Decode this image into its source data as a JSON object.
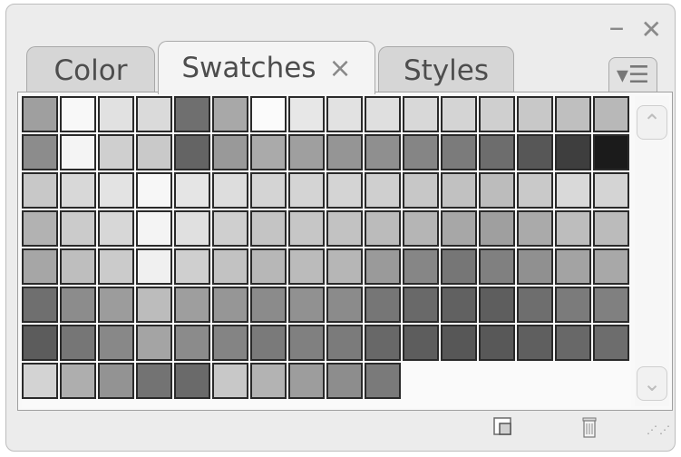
{
  "window": {
    "minimize_icon": "minus",
    "close_icon": "x"
  },
  "tabs": [
    {
      "label": "Color"
    },
    {
      "label": "Swatches",
      "close_symbol": "×"
    },
    {
      "label": "Styles"
    }
  ],
  "panel_menu_icon": "▾☰",
  "scrollbar": {
    "up_icon": "⌃",
    "down_icon": "⌄"
  },
  "swatches": [
    [
      "#9f9f9f",
      "#f8f8f8",
      "#e1e1e1",
      "#dadada",
      "#6f6f6f",
      "#a8a8a8",
      "#fbfbfb",
      "#e7e7e7",
      "#e2e2e2",
      "#dfdfdf",
      "#d8d8d8",
      "#d4d4d4",
      "#cfcfcf",
      "#c8c8c8",
      "#bfbfbf",
      "#b8b8b8"
    ],
    [
      "#8c8c8c",
      "#f4f4f4",
      "#cfcfcf",
      "#c9c9c9",
      "#646464",
      "#999999",
      "#aaaaaa",
      "#9f9f9f",
      "#959595",
      "#8f8f8f",
      "#858585",
      "#7b7b7b",
      "#6d6d6d",
      "#575757",
      "#3e3e3e",
      "#1b1b1b"
    ],
    [
      "#c8c8c8",
      "#d8d8d8",
      "#e3e3e3",
      "#f7f7f7",
      "#e5e5e5",
      "#dddddd",
      "#d4d4d4",
      "#d4d4d4",
      "#d4d4d4",
      "#cfcfcf",
      "#c7c7c7",
      "#c1c1c1",
      "#bcbcbc",
      "#c9c9c9",
      "#d9d9d9",
      "#d4d4d4"
    ],
    [
      "#b2b2b2",
      "#cbcbcb",
      "#d7d7d7",
      "#f4f4f4",
      "#e0e0e0",
      "#cfcfcf",
      "#c4c4c4",
      "#c6c6c6",
      "#c2c2c2",
      "#bbbbbb",
      "#b5b5b5",
      "#a7a7a7",
      "#9f9f9f",
      "#aaaaaa",
      "#bdbdbd",
      "#bbbbbb"
    ],
    [
      "#a6a6a6",
      "#bebebe",
      "#cbcbcb",
      "#f0f0f0",
      "#cfcfcf",
      "#c2c2c2",
      "#b7b7b7",
      "#bbbbbb",
      "#b6b6b6",
      "#9a9a9a",
      "#868686",
      "#767676",
      "#808080",
      "#909090",
      "#a3a3a3",
      "#a8a8a8"
    ],
    [
      "#6f6f6f",
      "#8c8c8c",
      "#9c9c9c",
      "#bcbcbc",
      "#9e9e9e",
      "#969696",
      "#8b8b8b",
      "#919191",
      "#8b8b8b",
      "#767676",
      "#696969",
      "#616161",
      "#5e5e5e",
      "#6e6e6e",
      "#7b7b7b",
      "#808080"
    ],
    [
      "#5c5c5c",
      "#767676",
      "#888888",
      "#a4a4a4",
      "#8b8b8b",
      "#848484",
      "#7a7a7a",
      "#808080",
      "#7b7b7b",
      "#686868",
      "#5d5d5d",
      "#575757",
      "#585858",
      "#5f5f5f",
      "#686868",
      "#6d6d6d"
    ],
    [
      "#d3d3d3",
      "#aeaeae",
      "#939393",
      "#737373",
      "#6a6a6a",
      "#c8c8c8",
      "#b3b3b3",
      "#9d9d9d",
      "#8d8d8d",
      "#7a7a7a"
    ]
  ],
  "footer": {
    "new_swatch_icon": "new-swatch",
    "delete_icon": "trash"
  }
}
